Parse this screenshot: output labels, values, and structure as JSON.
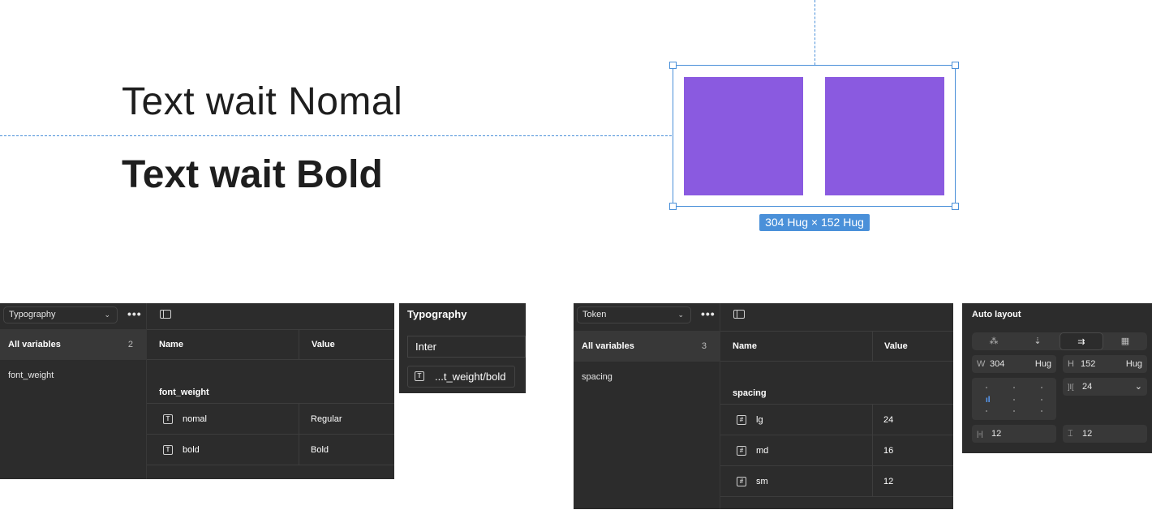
{
  "canvas": {
    "text_normal": "Text wait Nomal",
    "text_bold": "Text wait Bold",
    "size_badge": "304 Hug × 152 Hug",
    "frame_fill_color": "#8a5ae0",
    "selection_color": "#4a90d9"
  },
  "typography_panel": {
    "collection_select": "Typography",
    "collection_chevron": "⌄",
    "more_icon": "•••",
    "all_variables_label": "All variables",
    "all_variables_count": "2",
    "groups": [
      "font_weight"
    ],
    "columns": {
      "name": "Name",
      "value": "Value"
    },
    "group_title": "font_weight",
    "rows": [
      {
        "icon": "T",
        "name": "nomal",
        "value": "Regular"
      },
      {
        "icon": "T",
        "name": "bold",
        "value": "Bold"
      }
    ]
  },
  "typography_popover": {
    "title": "Typography",
    "font_family": "Inter",
    "weight_variable_icon": "T",
    "weight_variable": "...t_weight/bold"
  },
  "token_panel": {
    "collection_select": "Token",
    "collection_chevron": "⌄",
    "more_icon": "•••",
    "all_variables_label": "All variables",
    "all_variables_count": "3",
    "groups": [
      "spacing"
    ],
    "columns": {
      "name": "Name",
      "value": "Value"
    },
    "group_title": "spacing",
    "rows": [
      {
        "icon": "#",
        "name": "lg",
        "value": "24"
      },
      {
        "icon": "#",
        "name": "md",
        "value": "16"
      },
      {
        "icon": "#",
        "name": "sm",
        "value": "12"
      }
    ]
  },
  "auto_layout": {
    "title": "Auto layout",
    "direction_icons": [
      "⁂",
      "⇣",
      "⇉",
      "▦"
    ],
    "active_direction": 2,
    "width_label": "W",
    "width_value": "304",
    "width_mode": "Hug",
    "height_label": "H",
    "height_value": "152",
    "height_mode": "Hug",
    "gap_icon": "]I[",
    "gap_value": "24",
    "gap_chevron": "⌄",
    "align_marker": "ıl",
    "padding_h_icon": "|▫|",
    "padding_h_value": "12",
    "padding_v_icon": "⌶",
    "padding_v_value": "12"
  }
}
